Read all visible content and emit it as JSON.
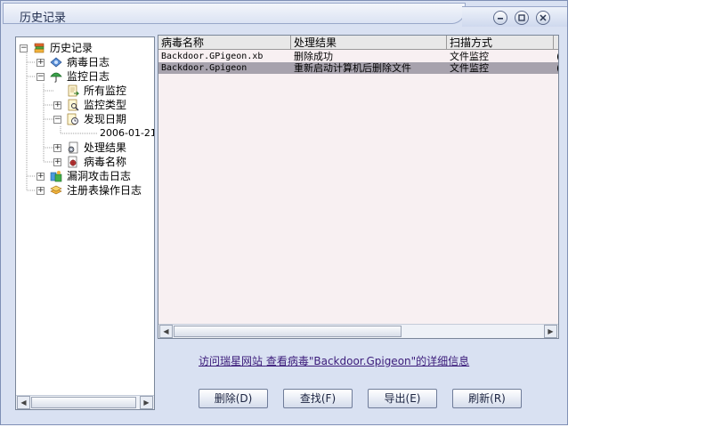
{
  "window": {
    "title": "历史记录",
    "controls": {
      "minimize": "minimize-icon",
      "restore": "restore-icon",
      "close": "close-icon"
    }
  },
  "tree": {
    "root": "历史记录",
    "virus_log": "病毒日志",
    "monitor_log": "监控日志",
    "all_monitor": "所有监控",
    "monitor_type": "监控类型",
    "found_date": "发现日期",
    "date_value": "2006-01-21",
    "result": "处理结果",
    "virus_name": "病毒名称",
    "exploit_log": "漏洞攻击日志",
    "registry_log": "注册表操作日志"
  },
  "table": {
    "columns": [
      "病毒名称",
      "处理结果",
      "扫描方式",
      ""
    ],
    "rows": [
      [
        "Backdoor.GPigeon.xb",
        "删除成功",
        "文件监控",
        "("
      ],
      [
        "Backdoor.Gpigeon",
        "重新启动计算机后删除文件",
        "文件监控",
        "("
      ]
    ],
    "selected_row": 1
  },
  "links": {
    "visit_site": "访问瑞星网站",
    "view_details": "查看病毒\"Backdoor.Gpigeon\"的详细信息"
  },
  "buttons": {
    "delete": "删除(D)",
    "find": "查找(F)",
    "export": "导出(E)",
    "refresh": "刷新(R)"
  },
  "colors": {
    "window_bg": "#d9e1f2",
    "list_bg": "#f8f0f2",
    "selected_row": "#a7a2ad",
    "link": "#3b1b7a"
  }
}
